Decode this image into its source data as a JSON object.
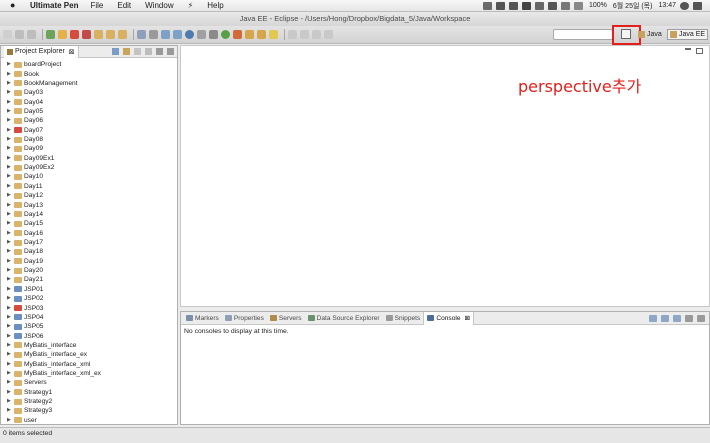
{
  "menubar": {
    "app_name": "Ultimate Pen",
    "items": [
      "File",
      "Edit",
      "Window",
      "Help"
    ],
    "battery": "100%",
    "date": "6월 25일 (목)",
    "time": "13:47"
  },
  "window": {
    "title": "Java EE - Eclipse - /Users/Hong/Dropbox/Bigdata_5/Java/Workspace"
  },
  "perspectives": {
    "java_label": "Java",
    "javaee_label": "Java EE"
  },
  "annotation": "perspective추가",
  "explorer": {
    "tab_label": "Project Explorer",
    "close": "⊠",
    "projects": [
      {
        "name": "boardProject",
        "icon": "folder"
      },
      {
        "name": "Book",
        "icon": "folder"
      },
      {
        "name": "BookManagement",
        "icon": "folder"
      },
      {
        "name": "Day03",
        "icon": "folder"
      },
      {
        "name": "Day04",
        "icon": "folder"
      },
      {
        "name": "Day05",
        "icon": "folder"
      },
      {
        "name": "Day06",
        "icon": "folder"
      },
      {
        "name": "Day07",
        "icon": "error"
      },
      {
        "name": "Day08",
        "icon": "folder"
      },
      {
        "name": "Day09",
        "icon": "folder"
      },
      {
        "name": "Day09Ex1",
        "icon": "folder"
      },
      {
        "name": "Day09Ex2",
        "icon": "folder"
      },
      {
        "name": "Day10",
        "icon": "folder"
      },
      {
        "name": "Day11",
        "icon": "folder"
      },
      {
        "name": "Day12",
        "icon": "folder"
      },
      {
        "name": "Day13",
        "icon": "folder"
      },
      {
        "name": "Day14",
        "icon": "folder"
      },
      {
        "name": "Day15",
        "icon": "folder"
      },
      {
        "name": "Day16",
        "icon": "folder"
      },
      {
        "name": "Day17",
        "icon": "folder"
      },
      {
        "name": "Day18",
        "icon": "folder"
      },
      {
        "name": "Day19",
        "icon": "folder"
      },
      {
        "name": "Day20",
        "icon": "folder"
      },
      {
        "name": "Day21",
        "icon": "folder"
      },
      {
        "name": "JSP01",
        "icon": "java"
      },
      {
        "name": "JSP02",
        "icon": "java"
      },
      {
        "name": "JSP03",
        "icon": "error"
      },
      {
        "name": "JSP04",
        "icon": "java"
      },
      {
        "name": "JSP05",
        "icon": "java"
      },
      {
        "name": "JSP06",
        "icon": "java"
      },
      {
        "name": "MyBatis_interface",
        "icon": "folder"
      },
      {
        "name": "MyBatis_interface_ex",
        "icon": "folder"
      },
      {
        "name": "MyBatis_interface_xml",
        "icon": "folder"
      },
      {
        "name": "MyBatis_interface_xml_ex",
        "icon": "folder"
      },
      {
        "name": "Servers",
        "icon": "folder"
      },
      {
        "name": "Strategy1",
        "icon": "folder"
      },
      {
        "name": "Strategy2",
        "icon": "folder"
      },
      {
        "name": "Strategy3",
        "icon": "folder"
      },
      {
        "name": "user",
        "icon": "folder"
      }
    ]
  },
  "bottom_panel": {
    "tabs": [
      {
        "label": "Markers",
        "color": "#7d8fa8",
        "active": false
      },
      {
        "label": "Properties",
        "color": "#8fa0b4",
        "active": false
      },
      {
        "label": "Servers",
        "color": "#b08a4a",
        "active": false
      },
      {
        "label": "Data Source Explorer",
        "color": "#6c8f6c",
        "active": false
      },
      {
        "label": "Snippets",
        "color": "#9a9a9a",
        "active": false
      },
      {
        "label": "Console",
        "color": "#4c6d9c",
        "active": true
      }
    ],
    "console_message": "No consoles to display at this time."
  },
  "status": {
    "text": "0 items selected"
  },
  "colors": {
    "annotation_red": "#e3201b"
  }
}
